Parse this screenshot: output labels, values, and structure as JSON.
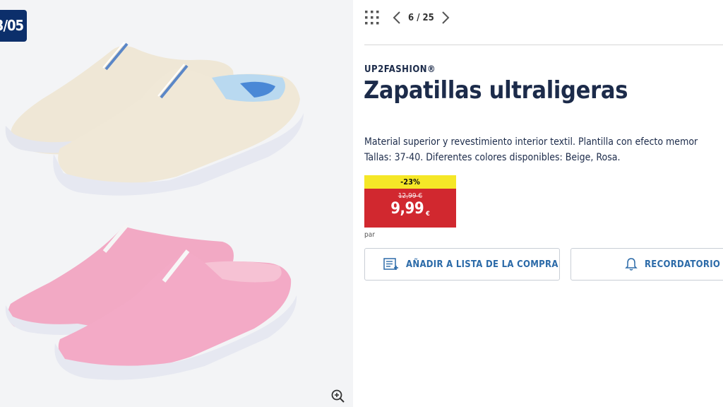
{
  "image_panel": {
    "date_badge": "3/05",
    "zoom_icon": "zoom-in-icon",
    "background": "#f3f4f6"
  },
  "nav": {
    "grid_icon": "grid-icon",
    "prev_icon": "chevron-left-icon",
    "next_icon": "chevron-right-icon",
    "pager": "6 / 25"
  },
  "product": {
    "brand": "UP2FASHION®",
    "title": "Zapatillas ultraligeras",
    "description_line1": "Material superior y revestimiento interior textil. Plantilla con efecto memor",
    "description_line2": "Tallas: 37-40. Diferentes colores disponibles: Beige, Rosa."
  },
  "price": {
    "discount": "-23%",
    "old_price": "12,99 €",
    "new_price": "9,99",
    "currency": "€",
    "unit": "par",
    "discount_color": "#f5e727",
    "price_color": "#d1282f"
  },
  "actions": {
    "add_list_label": "AÑADIR A LISTA DE LA COMPRA",
    "add_list_icon": "shopping-list-add-icon",
    "reminder_label": "RECORDATORIO",
    "reminder_icon": "bell-icon"
  },
  "colors": {
    "text": "#1c2b4a",
    "accent": "#2b6aa8",
    "badge": "#0c2f6b"
  }
}
